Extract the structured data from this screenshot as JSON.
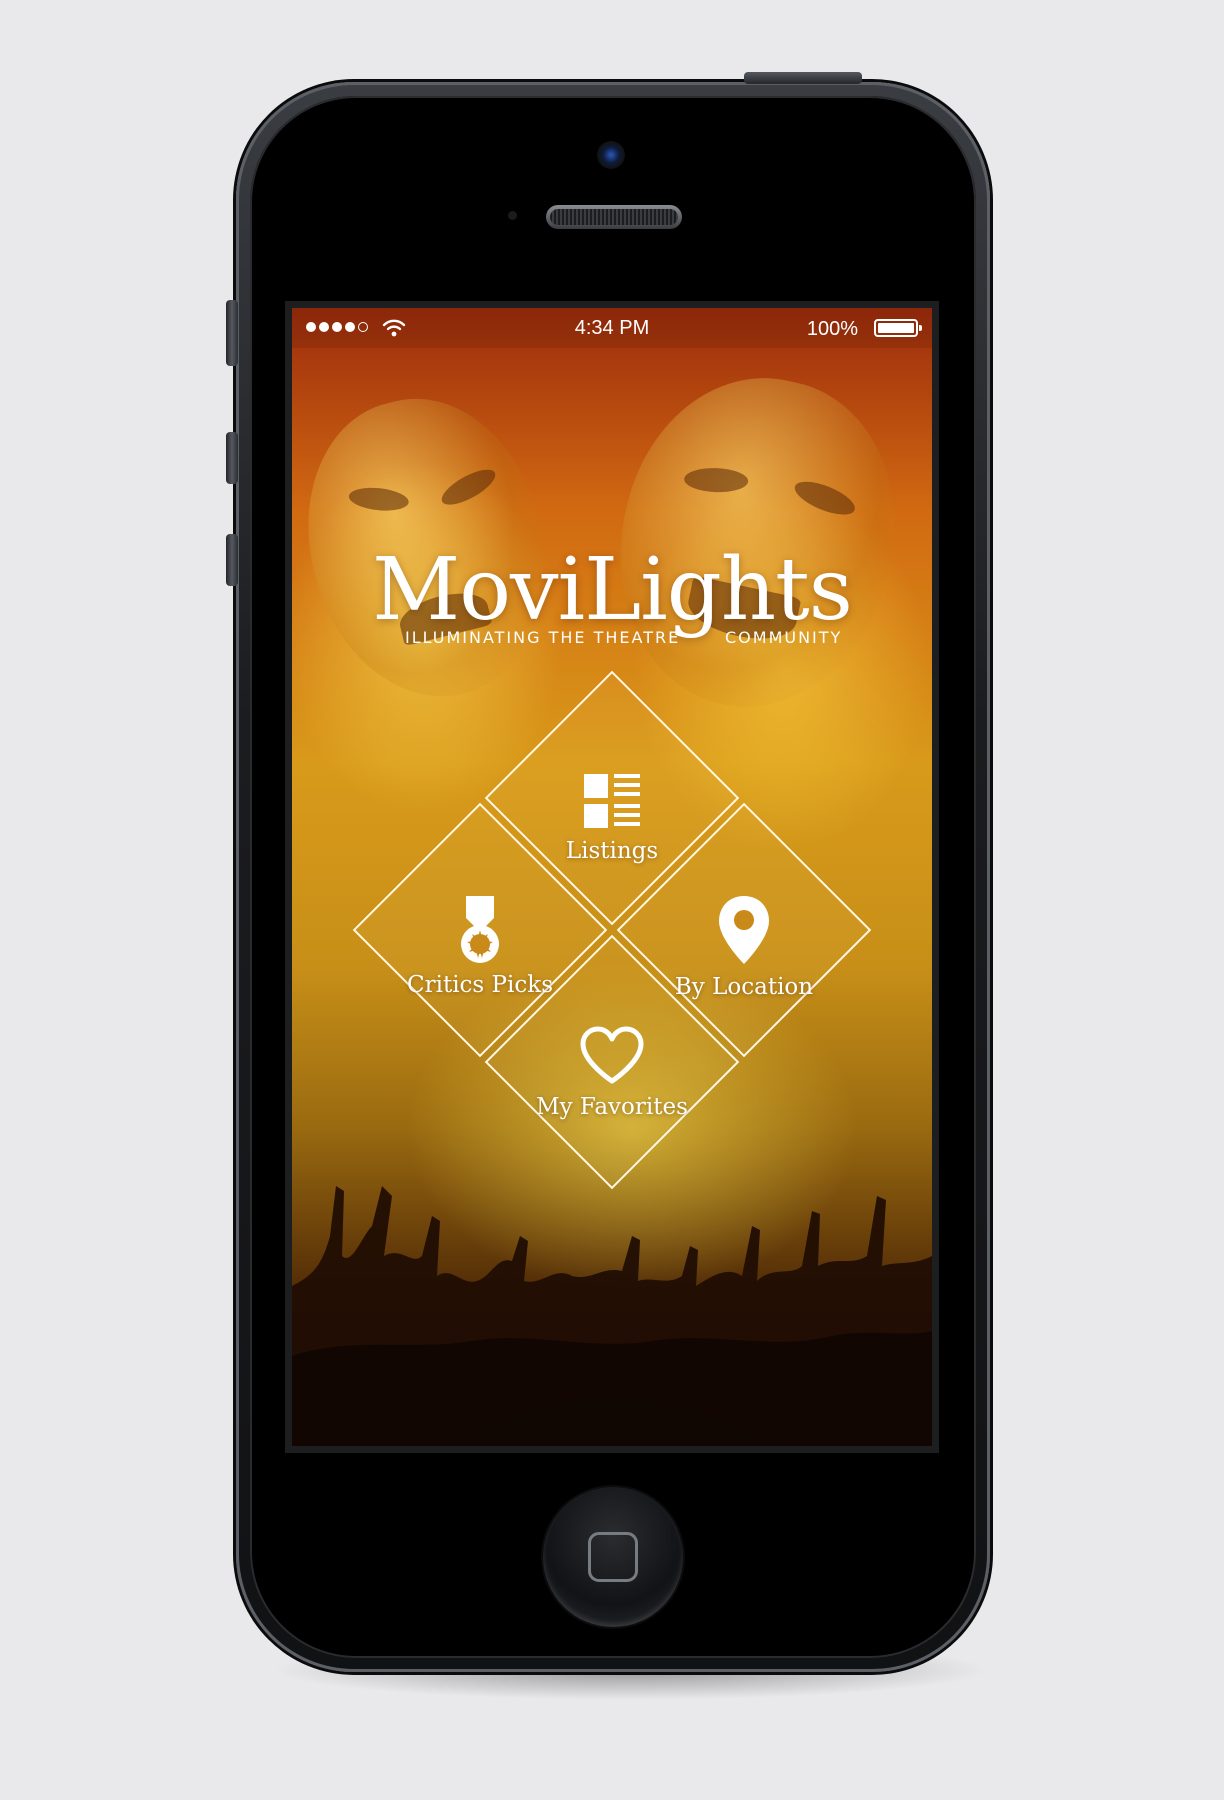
{
  "status_bar": {
    "time": "4:34 PM",
    "battery": "100%",
    "signal_icon": "signal-dots-icon",
    "wifi_icon": "wifi-icon",
    "battery_icon": "battery-icon"
  },
  "app": {
    "name": "MoviLights",
    "tagline_left": "ILLUMINATING THE THEATRE",
    "tagline_right": "COMMUNITY"
  },
  "menu": {
    "listings": {
      "label": "Listings",
      "icon": "listings-icon"
    },
    "critics_picks": {
      "label": "Critics Picks",
      "icon": "medal-icon"
    },
    "by_location": {
      "label": "By Location",
      "icon": "location-pin-icon"
    },
    "my_favorites": {
      "label": "My Favorites",
      "icon": "heart-icon"
    }
  },
  "colors": {
    "bg_top": "#9c2b0c",
    "bg_mid": "#d99a1a",
    "bg_bottom": "#1a0b03",
    "outline": "#fff8e6"
  }
}
